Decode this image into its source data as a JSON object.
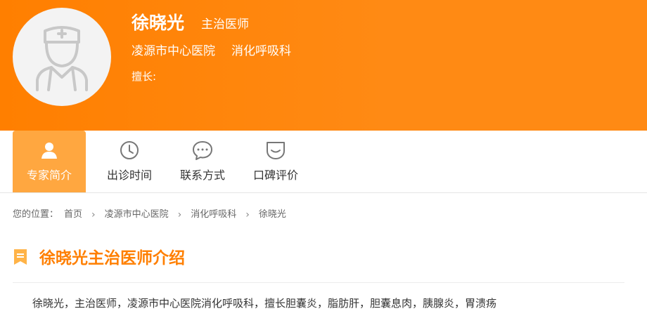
{
  "header": {
    "name": "徐晓光",
    "title": "主治医师",
    "hospital": "凌源市中心医院",
    "department": "消化呼吸科",
    "specialty_label": "擅长:",
    "bg_color": "#ff7f00"
  },
  "tabs": [
    {
      "label": "专家简介",
      "icon": "user-icon",
      "active": true
    },
    {
      "label": "出诊时间",
      "icon": "clock-icon",
      "active": false
    },
    {
      "label": "联系方式",
      "icon": "chat-icon",
      "active": false
    },
    {
      "label": "口碑评价",
      "icon": "smile-icon",
      "active": false
    }
  ],
  "breadcrumb": {
    "prefix": "您的位置：",
    "items": [
      "首页",
      "凌源市中心医院",
      "消化呼吸科",
      "徐晓光"
    ]
  },
  "section": {
    "title": "徐晓光主治医师介绍",
    "icon": "bookmark-icon",
    "accent": "#ff7f00"
  },
  "intro": {
    "text": "徐晓光，主治医师，凌源市中心医院消化呼吸科，擅长胆囊炎，脂肪肝，胆囊息肉，胰腺炎，胃溃疡"
  }
}
